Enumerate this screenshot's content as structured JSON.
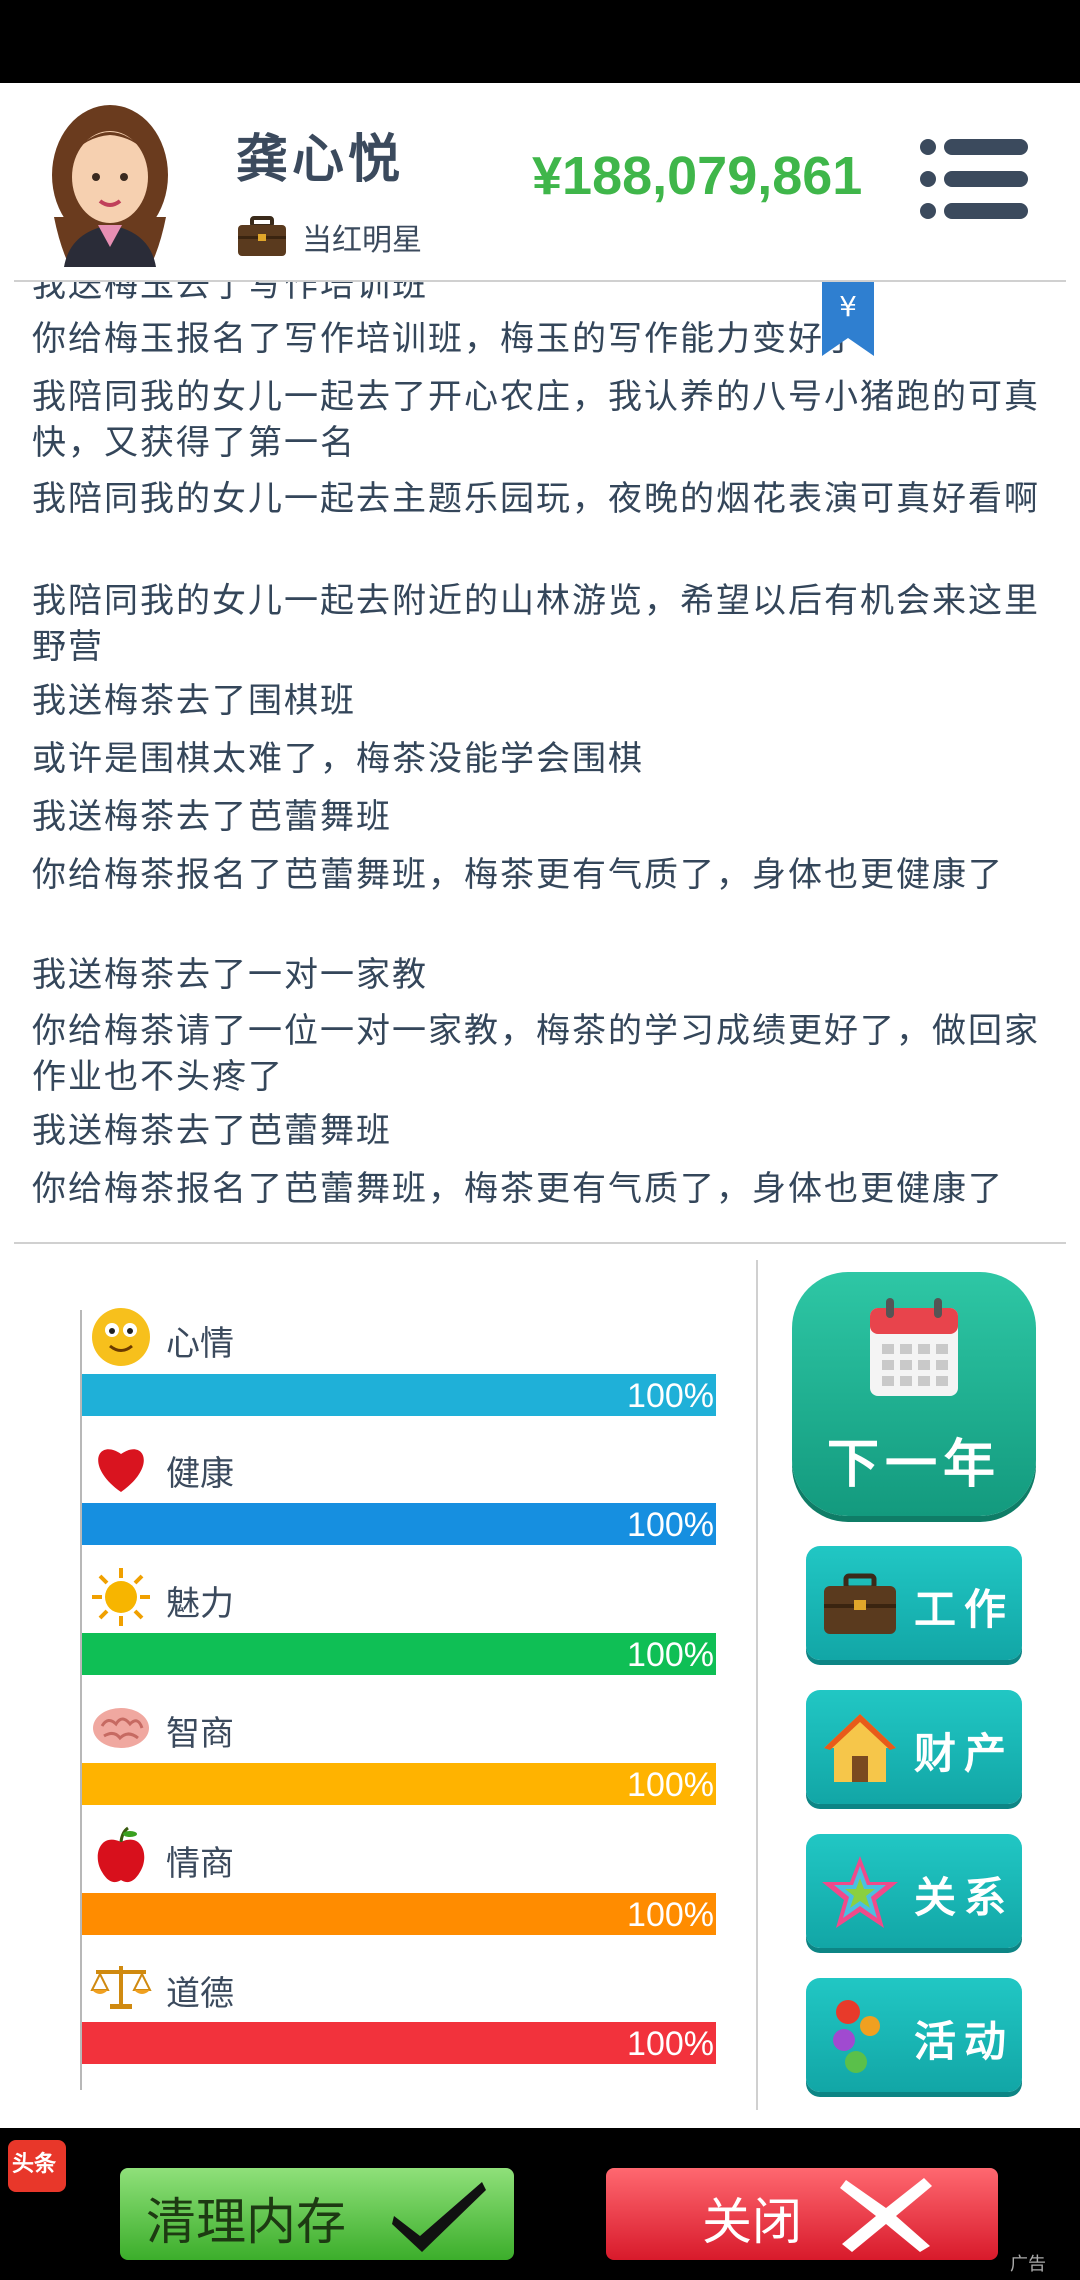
{
  "profile": {
    "name": "龚心悦",
    "title": "当红明星",
    "money": "¥188,079,861"
  },
  "log": [
    "我送梅玉去了写作培训班",
    "你给梅玉报名了写作培训班，梅玉的写作能力变好了",
    "我陪同我的女儿一起去了开心农庄，我认养的八号小猪跑的可真快，又获得了第一名",
    "我陪同我的女儿一起去主题乐园玩，夜晚的烟花表演可真好看啊",
    "我陪同我的女儿一起去附近的山林游览，希望以后有机会来这里野营",
    "我送梅茶去了围棋班",
    "或许是围棋太难了，梅茶没能学会围棋",
    "我送梅茶去了芭蕾舞班",
    "你给梅茶报名了芭蕾舞班，梅茶更有气质了，身体也更健康了",
    "我送梅茶去了一对一家教",
    "你给梅茶请了一位一对一家教，梅茶的学习成绩更好了，做回家作业也不头疼了",
    "我送梅茶去了芭蕾舞班",
    "你给梅茶报名了芭蕾舞班，梅茶更有气质了，身体也更健康了"
  ],
  "stats": [
    {
      "label": "心情",
      "value": 1.0,
      "pct": "100%",
      "color": "#1fb0d8",
      "icon": "smiley-icon"
    },
    {
      "label": "健康",
      "value": 1.0,
      "pct": "100%",
      "color": "#168fe0",
      "icon": "heart-icon"
    },
    {
      "label": "魅力",
      "value": 1.0,
      "pct": "100%",
      "color": "#0fbf55",
      "icon": "sun-icon"
    },
    {
      "label": "智商",
      "value": 1.0,
      "pct": "100%",
      "color": "#ffb300",
      "icon": "brain-icon"
    },
    {
      "label": "情商",
      "value": 1.0,
      "pct": "100%",
      "color": "#ff8c00",
      "icon": "apple-icon"
    },
    {
      "label": "道德",
      "value": 1.0,
      "pct": "100%",
      "color": "#f2323c",
      "icon": "scales-icon"
    }
  ],
  "actions": {
    "next_year": "下一年",
    "work": "工作",
    "property": "财产",
    "relations": "关系",
    "activities": "活动"
  },
  "ad": {
    "logo_text": "头条",
    "clean": "清理内存",
    "close": "关闭",
    "tag": "广告"
  },
  "yen_flag": "¥"
}
